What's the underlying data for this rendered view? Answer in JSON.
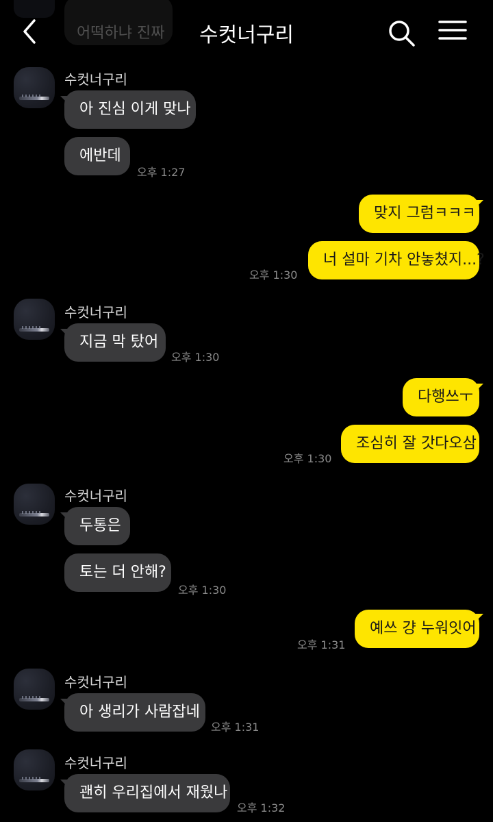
{
  "header": {
    "title": "수컷너구리",
    "back_icon": "back-arrow-icon",
    "search_icon": "search-icon",
    "menu_icon": "hamburger-menu-icon"
  },
  "colors": {
    "background": "#000000",
    "incoming_bubble": "#3a3a3c",
    "outgoing_bubble": "#fee500",
    "timestamp": "#8a8a8a"
  },
  "previous_message": {
    "text": "어떡하냐 진짜"
  },
  "messages": [
    {
      "sender": "수컷너구리",
      "lines": [
        "아 진심 이게 맞나",
        "에반데"
      ],
      "time": "오후 1:27"
    },
    {
      "sender": "me",
      "lines": [
        "맞지 그럼ㅋㅋㅋ",
        "너 설마 기차 안놓쳤지...?"
      ],
      "time": "오후 1:30"
    },
    {
      "sender": "수컷너구리",
      "lines": [
        "지금 막 탔어"
      ],
      "time": "오후 1:30"
    },
    {
      "sender": "me",
      "lines": [
        "다행쓰ㅜ",
        "조심히 잘 갓다오삼"
      ],
      "time": "오후 1:30"
    },
    {
      "sender": "수컷너구리",
      "lines": [
        "두통은",
        "토는 더 안해?"
      ],
      "time": "오후 1:30"
    },
    {
      "sender": "me",
      "lines": [
        "예쓰 걍 누워잇어"
      ],
      "time": "오후 1:31"
    },
    {
      "sender": "수컷너구리",
      "lines": [
        "아 생리가 사람잡네"
      ],
      "time": "오후 1:31"
    },
    {
      "sender": "수컷너구리",
      "lines": [
        "괜히 우리집에서 재웠나"
      ],
      "time": "오후 1:32"
    }
  ]
}
